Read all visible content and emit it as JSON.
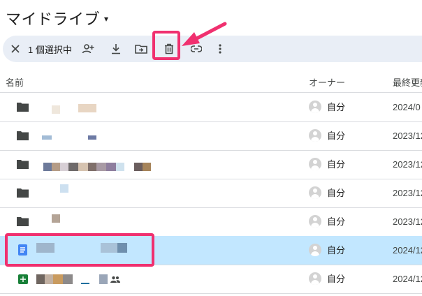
{
  "header": {
    "title": "マイドライブ",
    "caret": "▾"
  },
  "toolbar": {
    "selection_label": "1 個選択中",
    "icons": [
      "close-icon",
      "add-person-icon",
      "download-icon",
      "move-to-folder-icon",
      "trash-icon",
      "link-icon",
      "more-vert-icon"
    ]
  },
  "columns": {
    "name": "名前",
    "owner": "オーナー",
    "modified": "最終更新"
  },
  "rows": [
    {
      "type": "folder",
      "owner": "自分",
      "date": "2024/0"
    },
    {
      "type": "folder",
      "owner": "自分",
      "date": "2023/12"
    },
    {
      "type": "folder",
      "owner": "自分",
      "date": "2023/12"
    },
    {
      "type": "folder",
      "owner": "自分",
      "date": "2023/12"
    },
    {
      "type": "folder",
      "owner": "自分",
      "date": "2023/12"
    },
    {
      "type": "doc",
      "owner": "自分",
      "date": "2024/12",
      "selected": true
    },
    {
      "type": "sheet",
      "owner": "自分",
      "date": "2024/12",
      "shared": true
    }
  ],
  "colors": {
    "selected_row": "#c2e7ff",
    "highlight": "#f0306f",
    "toolbar_bg": "#e9eef6"
  }
}
